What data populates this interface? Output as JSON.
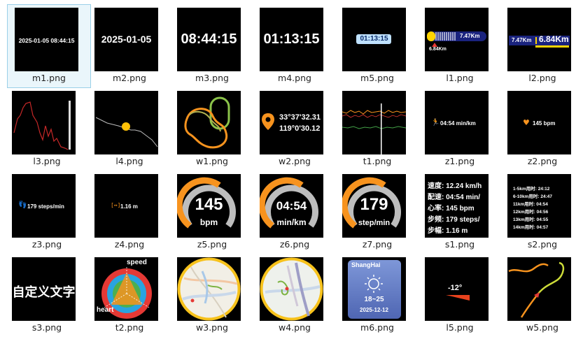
{
  "files": [
    {
      "name": "m1.png",
      "selected": true,
      "text": "2025-01-05 08:44:15"
    },
    {
      "name": "m2.png",
      "text": "2025-01-05"
    },
    {
      "name": "m3.png",
      "text": "08:44:15"
    },
    {
      "name": "m4.png",
      "text": "01:13:15"
    },
    {
      "name": "m5.png",
      "text": "01:13:15"
    },
    {
      "name": "l1.png",
      "text": "7.47Km",
      "text2": "6.84Km"
    },
    {
      "name": "l2.png",
      "text": "7.47Km",
      "text2": "6.84Km"
    },
    {
      "name": "l3.png"
    },
    {
      "name": "l4.png"
    },
    {
      "name": "w1.png"
    },
    {
      "name": "w2.png",
      "text": "33°37'32.31",
      "text2": "119°0'30.12"
    },
    {
      "name": "t1.png"
    },
    {
      "name": "z1.png",
      "text": "04:54 min/km"
    },
    {
      "name": "z2.png",
      "text": "145 bpm"
    },
    {
      "name": "z3.png",
      "text": "179 steps/min"
    },
    {
      "name": "z4.png",
      "text": "1.16 m"
    },
    {
      "name": "z5.png",
      "text": "145",
      "text2": "bpm",
      "value_fraction": 0.75
    },
    {
      "name": "z6.png",
      "text": "04:54",
      "text2": "min/km",
      "value_fraction": 0.75
    },
    {
      "name": "z7.png",
      "text": "179",
      "text2": "step/min",
      "value_fraction": 0.75
    },
    {
      "name": "s1.png",
      "lines": [
        "速度: 12.24 km/h",
        "配速: 04:54 min/",
        "心率: 145 bpm",
        "步频: 179 steps/",
        "步幅: 1.16 m"
      ]
    },
    {
      "name": "s2.png",
      "lines": [
        "1-5km用时: 24:12",
        "6-10km用时: 24:47",
        "11km用时: 04:54",
        "12km用时: 04:56",
        "13km用时: 04:55",
        "14km用时: 04:57"
      ]
    },
    {
      "name": "s3.png",
      "text": "自定义文字"
    },
    {
      "name": "t2.png",
      "text": "speed",
      "text2": "heart"
    },
    {
      "name": "w3.png"
    },
    {
      "name": "w4.png"
    },
    {
      "name": "m6.png",
      "text": "ShangHai",
      "text2": "18~25",
      "text3": "2025-12-12"
    },
    {
      "name": "l5.png",
      "text": "-12°"
    },
    {
      "name": "w5.png"
    }
  ],
  "colors": {
    "accent": "#f7931e",
    "selection": "#9ad0e8"
  }
}
